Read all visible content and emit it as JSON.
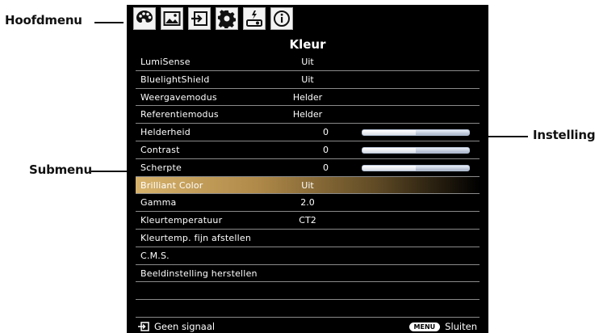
{
  "callouts": {
    "hoofdmenu": "Hoofdmenu",
    "submenu": "Submenu",
    "instelling": "Instelling"
  },
  "osd": {
    "title": "Kleur",
    "tab_icons": [
      "palette-icon",
      "image-icon",
      "input-icon",
      "gear-icon",
      "projector-power-icon",
      "info-icon"
    ],
    "rows": [
      {
        "label": "LumiSense",
        "value": "Uit"
      },
      {
        "label": "BluelightShield",
        "value": "Uit"
      },
      {
        "label": "Weergavemodus",
        "value": "Helder"
      },
      {
        "label": "Referentiemodus",
        "value": "Helder"
      },
      {
        "label": "Helderheid",
        "number": "0",
        "level": 0.5
      },
      {
        "label": "Contrast",
        "number": "0",
        "level": 0.5
      },
      {
        "label": "Scherpte",
        "number": "0",
        "level": 0.5
      },
      {
        "label": "Brilliant Color",
        "value": "Uit",
        "selected": true
      },
      {
        "label": "Gamma",
        "value": "2.0"
      },
      {
        "label": "Kleurtemperatuur",
        "value": "CT2"
      },
      {
        "label": "Kleurtemp. fijn afstellen",
        "value": ""
      },
      {
        "label": "C.M.S.",
        "value": ""
      },
      {
        "label": "Beeldinstelling herstellen",
        "value": ""
      },
      {
        "label": "",
        "value": ""
      },
      {
        "label": "",
        "value": ""
      }
    ],
    "footer": {
      "source_status": "Geen signaal",
      "menu_key": "MENU",
      "close_label": "Sluiten"
    }
  }
}
